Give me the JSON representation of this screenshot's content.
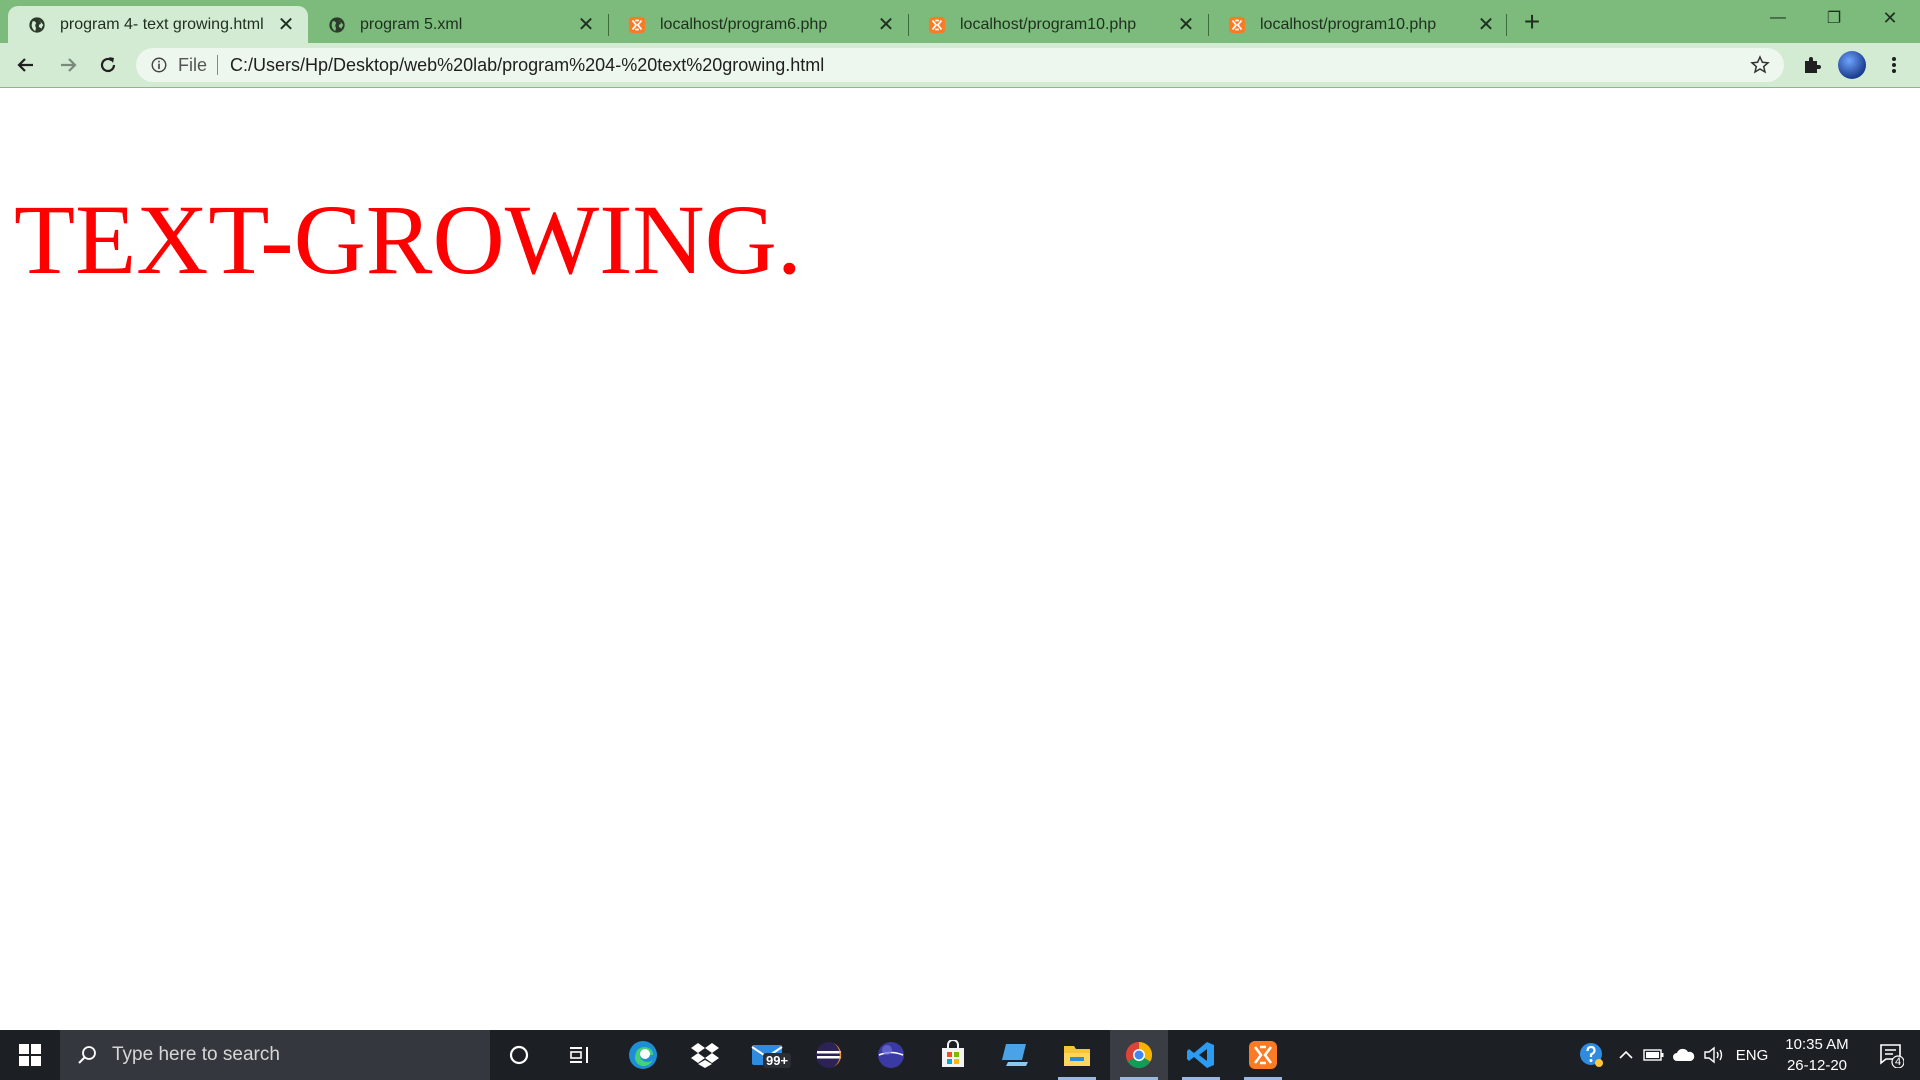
{
  "browser": {
    "tabs": [
      {
        "title": "program 4- text growing.html",
        "favicon": "globe-icon",
        "active": true
      },
      {
        "title": "program 5.xml",
        "favicon": "globe-icon",
        "active": false
      },
      {
        "title": "localhost/program6.php",
        "favicon": "xampp-icon",
        "active": false
      },
      {
        "title": "localhost/program10.php",
        "favicon": "xampp-icon",
        "active": false
      },
      {
        "title": "localhost/program10.php",
        "favicon": "xampp-icon",
        "active": false
      }
    ],
    "close_glyph": "✕",
    "new_tab_glyph": "+",
    "window_controls": {
      "minimize": "—",
      "restore": "❐",
      "close": "✕"
    },
    "address": {
      "scheme_label": "File",
      "url": "C:/Users/Hp/Desktop/web%20lab/program%204-%20text%20growing.html"
    },
    "colors": {
      "frame": "#7dbb7d",
      "toolbar": "#d3ead3"
    }
  },
  "page": {
    "text": "TEXT-GROWING.",
    "text_color": "#ff0000"
  },
  "taskbar": {
    "search_placeholder": "Type here to search",
    "mail_badge": "99+",
    "language": "ENG",
    "time": "10:35 AM",
    "date": "26-12-20",
    "notification_count": "4",
    "apps": [
      "cortana-icon",
      "task-view-icon",
      "edge-icon",
      "dropbox-icon",
      "mail-icon",
      "eclipse-icon",
      "eclipse-ide-icon",
      "store-icon",
      "remote-desktop-icon",
      "file-explorer-icon",
      "chrome-icon",
      "vscode-icon",
      "xampp-icon"
    ]
  }
}
